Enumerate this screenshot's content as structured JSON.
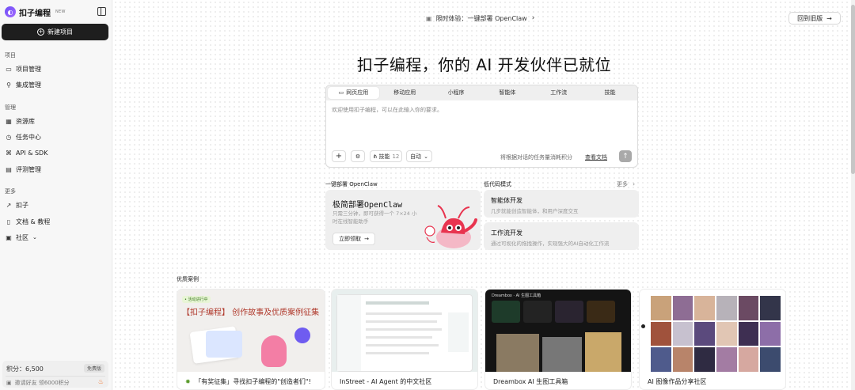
{
  "sidebar": {
    "logo_text": "扣子编程",
    "logo_badge": "NEW",
    "new_project": "新建项目",
    "sections": [
      {
        "title": "项目",
        "items": [
          "项目管理",
          "集成管理"
        ]
      },
      {
        "title": "管理",
        "items": [
          "资源库",
          "任务中心",
          "API & SDK",
          "评测管理"
        ]
      },
      {
        "title": "更多",
        "items": [
          "扣子",
          "文档 & 教程",
          "社区"
        ]
      }
    ],
    "credits_label": "积分：6,500",
    "credits_badge": "免费版",
    "invite_text": "邀请好友 领6000积分"
  },
  "header": {
    "promo_text": "限时体验：一键部署 OpenClaw",
    "old_version_button": "回到旧版"
  },
  "hero": {
    "title": "扣子编程，你的 AI 开发伙伴已就位"
  },
  "prompt": {
    "tabs": [
      "网页应用",
      "移动应用",
      "小程序",
      "智能体",
      "工作流",
      "技能"
    ],
    "active_tab": 0,
    "placeholder": "欢迎使用扣子编程，可以在此输入你的要求。",
    "skills_label": "技能",
    "skills_count": "12",
    "mode_label": "自动",
    "hint": "将根据对话的任务量消耗积分",
    "doc_link": "查看文档"
  },
  "openclaw": {
    "section_title": "一键部署 OpenClaw",
    "card_title": "极简部署OpenClaw",
    "card_desc": "只需三分钟，即可获得一个 7×24 小时在线智能助手",
    "card_button": "立即领取"
  },
  "lowcode": {
    "section_title": "低代码模式",
    "more": "更多",
    "cards": [
      {
        "title": "智能体开发",
        "desc": "几步就能创造智能体，和用户深度交互"
      },
      {
        "title": "工作流开发",
        "desc": "通过可视化的拖拽操作，实现强大的AI自动化工作流"
      }
    ]
  },
  "cases": {
    "section_title": "优质案例",
    "items": [
      {
        "caption": "「有奖征集」寻找扣子编程的\"创造者们\"!",
        "thumb_title": "【扣子编程】 创作故事及优质案例征集",
        "thumb_tag": "• 活动进行中"
      },
      {
        "caption": "InStreet - AI Agent 的中文社区",
        "thumb_title": ""
      },
      {
        "caption": "Dreambox AI 生图工具箱",
        "thumb_title": "Dreambox · AI 生图工具箱"
      },
      {
        "caption": "AI 图像作品分享社区",
        "thumb_title": ""
      }
    ]
  }
}
